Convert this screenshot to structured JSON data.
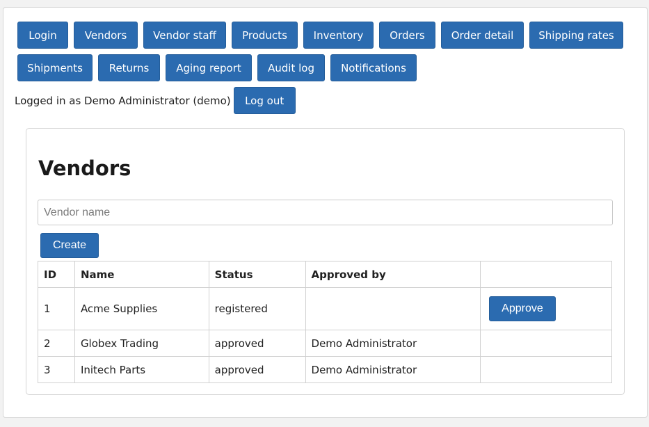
{
  "nav": {
    "row1": [
      "Login",
      "Vendors",
      "Vendor staff",
      "Products",
      "Inventory",
      "Orders",
      "Order detail",
      "Shipping rates"
    ],
    "row2": [
      "Shipments",
      "Returns",
      "Aging report",
      "Audit log",
      "Notifications"
    ]
  },
  "session": {
    "logged_in_text": "Logged in as Demo Administrator (demo)",
    "logout_label": "Log out"
  },
  "main": {
    "title": "Vendors",
    "vendor_input": {
      "placeholder": "Vendor name",
      "value": ""
    },
    "create_label": "Create",
    "table": {
      "headers": [
        "ID",
        "Name",
        "Status",
        "Approved by",
        ""
      ],
      "rows": [
        {
          "id": "1",
          "name": "Acme Supplies",
          "status": "registered",
          "approved_by": "",
          "action": "Approve"
        },
        {
          "id": "2",
          "name": "Globex Trading",
          "status": "approved",
          "approved_by": "Demo Administrator",
          "action": ""
        },
        {
          "id": "3",
          "name": "Initech Parts",
          "status": "approved",
          "approved_by": "Demo Administrator",
          "action": ""
        }
      ]
    }
  },
  "colors": {
    "button": "#2b6bb0",
    "button_text": "#ffffff",
    "border": "#d0d0d0"
  }
}
